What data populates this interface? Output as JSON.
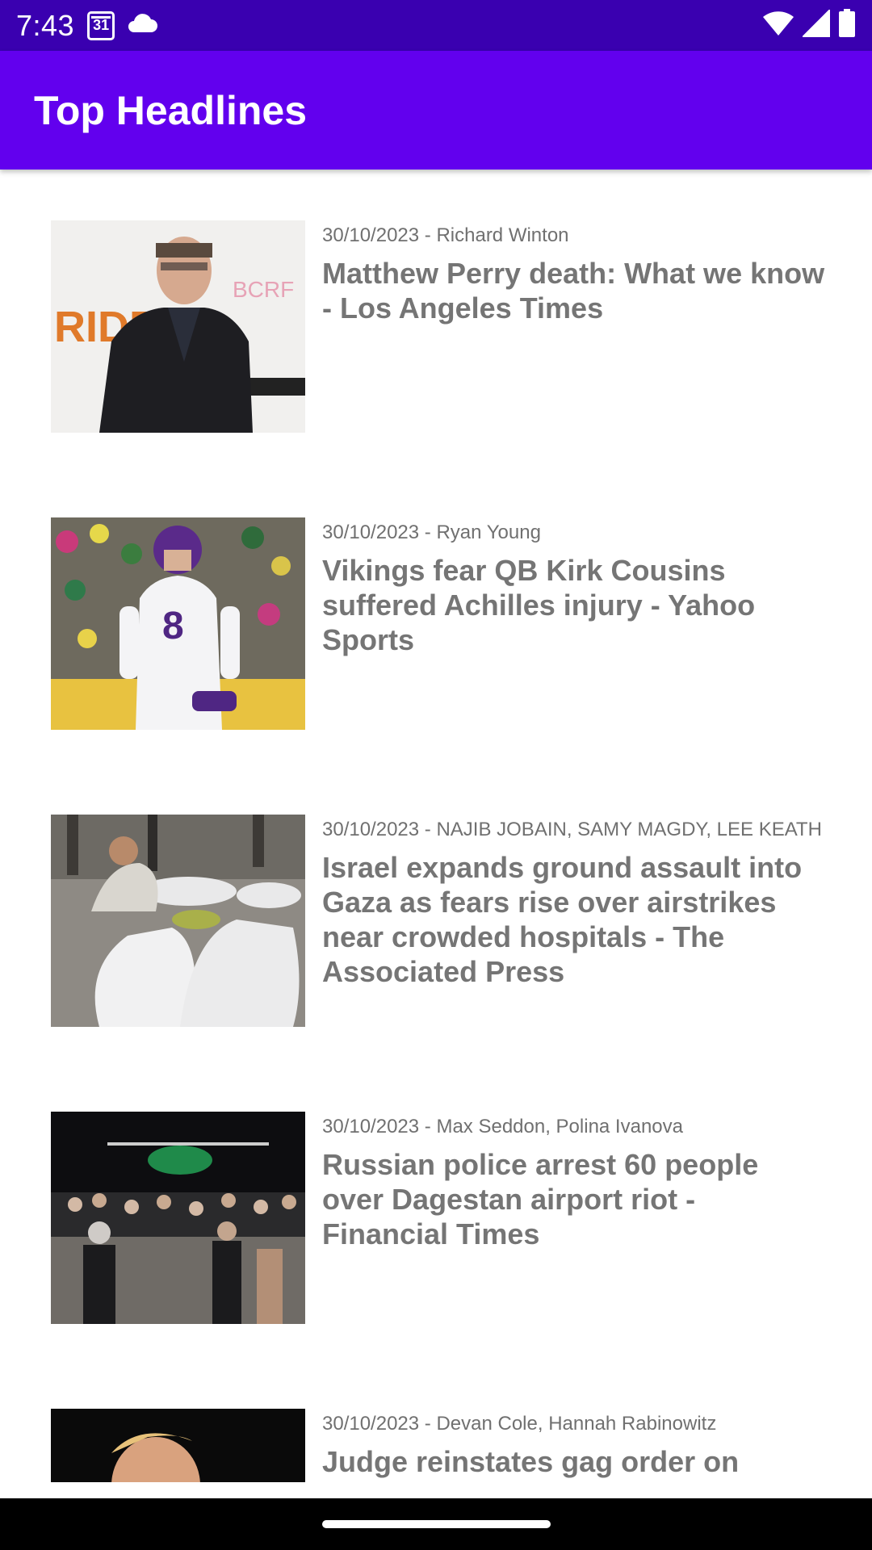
{
  "status_bar": {
    "time": "7:43",
    "calendar_day": "31",
    "icons": [
      "calendar-icon",
      "cloud-icon",
      "wifi-icon",
      "signal-icon",
      "battery-icon"
    ]
  },
  "app_bar": {
    "title": "Top Headlines",
    "color": "#6200ee"
  },
  "articles": [
    {
      "date": "30/10/2023",
      "authors": "Richard Winton",
      "title": "Matthew Perry death: What we know - Los Angeles Times"
    },
    {
      "date": "30/10/2023",
      "authors": "Ryan Young",
      "title": "Vikings fear QB Kirk Cousins suffered Achilles injury - Yahoo Sports"
    },
    {
      "date": "30/10/2023",
      "authors": "NAJIB JOBAIN, SAMY MAGDY, LEE KEATH",
      "title": "Israel expands ground assault into Gaza as fears rise over airstrikes near crowded hospitals - The Associated Press"
    },
    {
      "date": "30/10/2023",
      "authors": "Max Seddon, Polina Ivanova",
      "title": "Russian police arrest 60 people over Dagestan airport riot - Financial Times"
    },
    {
      "date": "30/10/2023",
      "authors": "Devan Cole, Hannah Rabinowitz",
      "title": "Judge reinstates gag order on"
    }
  ]
}
